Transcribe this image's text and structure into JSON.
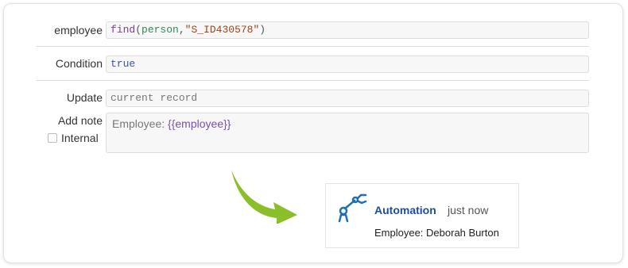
{
  "form": {
    "employee": {
      "label": "employee",
      "fn": "find",
      "open_paren": "(",
      "arg1": "person",
      "comma": ",",
      "arg2": "\"S_ID430578\"",
      "close_paren": ")"
    },
    "condition": {
      "label": "Condition",
      "value": "true"
    },
    "update": {
      "label": "Update",
      "value": "current record"
    },
    "add_note": {
      "label": "Add note",
      "prefix": "Employee: ",
      "variable": "{{employee}}"
    },
    "internal": {
      "label": "Internal",
      "checked": false
    }
  },
  "notification": {
    "icon": "robot-arm-icon",
    "author": "Automation",
    "time": "just now",
    "text": "Employee: Deborah Burton"
  },
  "colors": {
    "arrow": "#8bbf2a",
    "icon": "#1f6fb5",
    "author": "#1a4f9c"
  }
}
